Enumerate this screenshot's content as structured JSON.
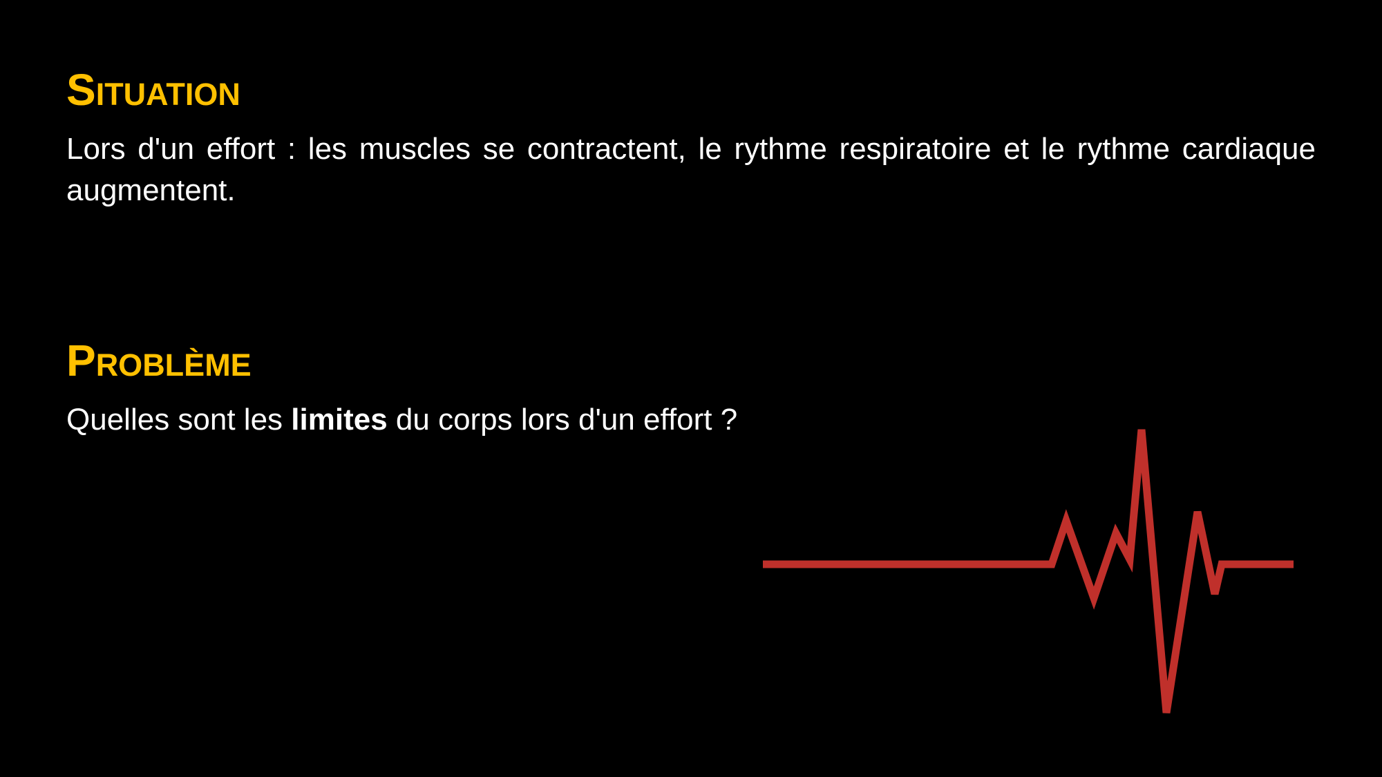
{
  "colors": {
    "background": "#000000",
    "heading": "#FFC000",
    "text": "#FFFFFF",
    "ecg_line": "#C0302B"
  },
  "situation": {
    "title": "Situation",
    "text": "Lors d'un effort : les muscles se contractent, le rythme respiratoire et le rythme cardiaque augmentent."
  },
  "probleme": {
    "title": "Problème",
    "question_before": "Quelles sont les ",
    "question_bold": "limites",
    "question_after": " du corps lors d'un effort ?"
  },
  "decoration": {
    "icon": "heartbeat-line-icon"
  }
}
